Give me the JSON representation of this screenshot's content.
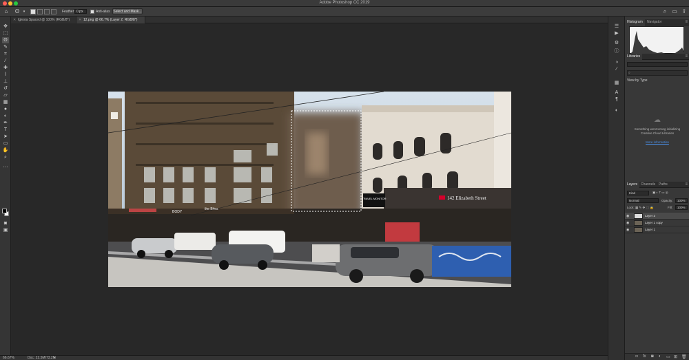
{
  "window": {
    "title": "Adobe Photoshop CC 2019"
  },
  "options_bar": {
    "feather_label": "Feather:",
    "feather_value": "0 px",
    "anti_alias_label": "Anti-alias",
    "select_mask_label": "Select and Mask..."
  },
  "tabs": [
    {
      "label": "Iglesia Spaced @ 100% (RGB/8*)"
    },
    {
      "label": "12.png @ 66.7% (Layer 2, RGB/8*)"
    }
  ],
  "status_bar": {
    "zoom": "66.67%",
    "doc_info": "Doc: 22.5M/73.2M"
  },
  "histogram_panel": {
    "tabs": [
      "Histogram",
      "Navigator"
    ]
  },
  "libraries_panel": {
    "tab": "Libraries",
    "view_by": "View by Type",
    "message": "Something went wrong initializing Creative Cloud Libraries",
    "link": "More information"
  },
  "layers_panel": {
    "tabs": [
      "Layers",
      "Channels",
      "Paths"
    ],
    "kind": "Kind",
    "blend_mode": "Normal",
    "opacity_label": "Opacity:",
    "opacity_value": "100%",
    "lock_label": "Lock:",
    "fill_label": "Fill:",
    "fill_value": "100%",
    "layers": [
      {
        "name": "Layer 2",
        "selected": true
      },
      {
        "name": "Layer 1 copy",
        "selected": false
      },
      {
        "name": "Layer 1",
        "selected": false
      }
    ]
  },
  "artwork": {
    "signs": {
      "travel_monitor": "TRAVEL MONITOR",
      "westpac": "142 Elizabeth Street",
      "body": "BODY",
      "the_bites": "the Bites"
    }
  },
  "colors": {
    "close_button": "#ff5f57",
    "minimize_button": "#ffbd2e",
    "zoom_button": "#28c940",
    "link_blue": "#4a8fe8",
    "westpac_red": "#d5002b"
  },
  "icons": {
    "tools": [
      "move-icon",
      "marquee-icon",
      "lasso-icon",
      "quick-select-icon",
      "crop-icon",
      "eyedropper-icon",
      "spot-heal-icon",
      "brush-icon",
      "clone-stamp-icon",
      "history-brush-icon",
      "eraser-icon",
      "gradient-icon",
      "blur-icon",
      "dodge-icon",
      "pen-icon",
      "type-icon",
      "path-select-icon",
      "rectangle-icon",
      "hand-icon",
      "zoom-icon",
      "more-tools-icon"
    ]
  }
}
